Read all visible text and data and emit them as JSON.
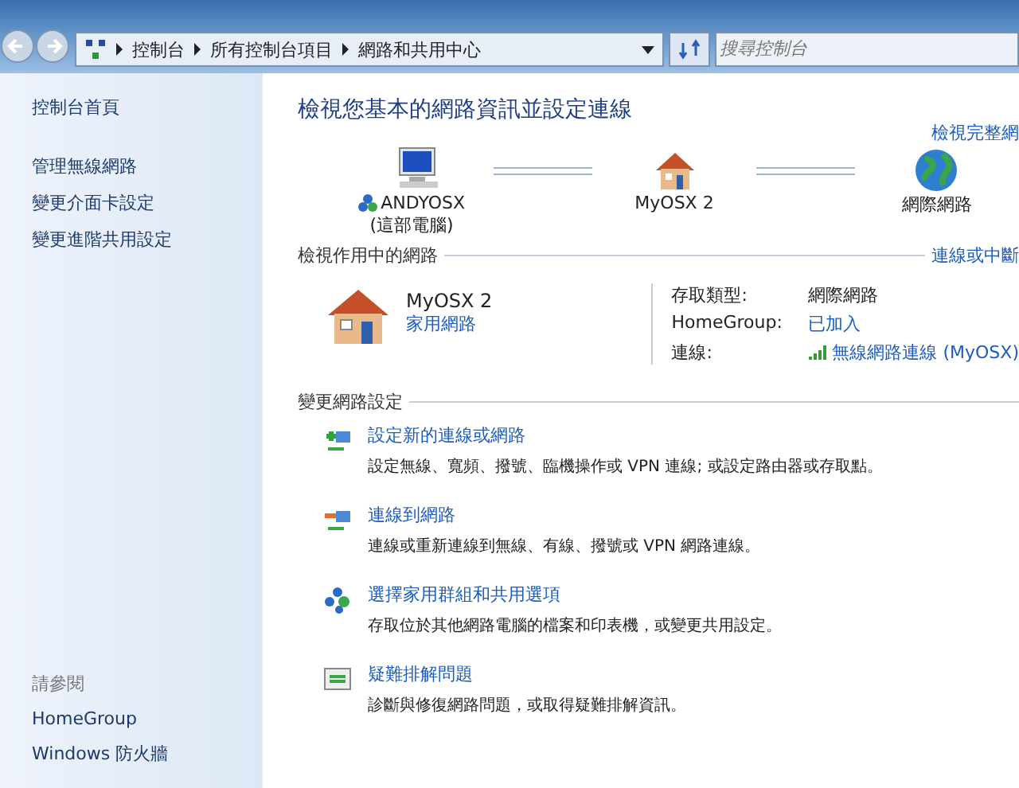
{
  "address_bar": {
    "breadcrumbs": [
      "控制台",
      "所有控制台項目",
      "網路和共用中心"
    ]
  },
  "search": {
    "placeholder": "搜尋控制台"
  },
  "sidebar": {
    "items": [
      "控制台首頁"
    ],
    "tasks": [
      "管理無線網路",
      "變更介面卡設定",
      "變更進階共用設定"
    ],
    "see_also_heading": "請參閱",
    "see_also": [
      "HomeGroup",
      "Windows 防火牆"
    ]
  },
  "main": {
    "title": "檢視您基本的網路資訊並設定連線",
    "map_link": "檢視完整網",
    "map": [
      {
        "kind": "computer",
        "name": "ANDYOSX",
        "sub": "(這部電腦)"
      },
      {
        "kind": "house",
        "name": "MyOSX  2"
      },
      {
        "kind": "globe",
        "name": "網際網路"
      }
    ],
    "active_heading": "檢視作用中的網路",
    "active_link": "連線或中斷",
    "network": {
      "name": "MyOSX  2",
      "type": "家用網路"
    },
    "details": [
      {
        "label": "存取類型:",
        "value": "網際網路",
        "kind": "text"
      },
      {
        "label": "HomeGroup:",
        "value": "已加入",
        "kind": "link"
      },
      {
        "label": "連線:",
        "value": "無線網路連線 (MyOSX)",
        "kind": "wifi"
      }
    ],
    "settings_heading": "變更網路設定",
    "tasks": [
      {
        "kind": "new",
        "title": "設定新的連線或網路",
        "desc": "設定無線、寬頻、撥號、臨機操作或 VPN 連線; 或設定路由器或存取點。"
      },
      {
        "kind": "connect",
        "title": "連線到網路",
        "desc": "連線或重新連線到無線、有線、撥號或 VPN 網路連線。"
      },
      {
        "kind": "homegroup",
        "title": "選擇家用群組和共用選項",
        "desc": "存取位於其他網路電腦的檔案和印表機，或變更共用設定。"
      },
      {
        "kind": "troubleshoot",
        "title": "疑難排解問題",
        "desc": "診斷與修復網路問題，或取得疑難排解資訊。"
      }
    ]
  }
}
